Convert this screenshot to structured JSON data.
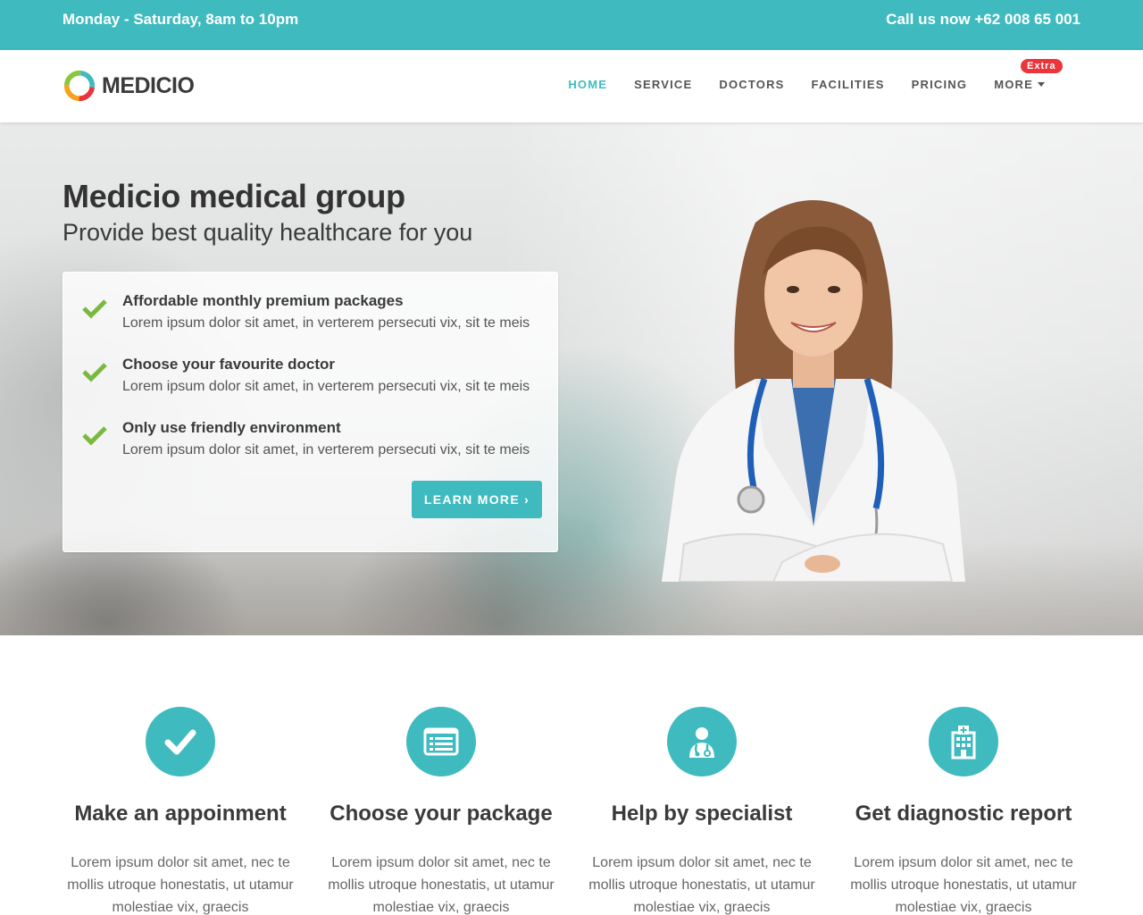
{
  "topbar": {
    "hours": "Monday - Saturday, 8am to 10pm",
    "phone": "Call us now +62 008 65 001"
  },
  "brand": {
    "name": "MEDICIO",
    "accent_color": "#3fbbc0",
    "badge_color": "#e9353b"
  },
  "nav": {
    "items": [
      {
        "label": "HOME",
        "active": true
      },
      {
        "label": "SERVICE"
      },
      {
        "label": "DOCTORS"
      },
      {
        "label": "FACILITIES"
      },
      {
        "label": "PRICING"
      },
      {
        "label": "MORE",
        "dropdown": true
      }
    ],
    "badge": "Extra"
  },
  "hero": {
    "title": "Medicio medical group",
    "subtitle": "Provide best quality healthcare for you",
    "features": [
      {
        "title": "Affordable monthly premium packages",
        "desc": "Lorem ipsum dolor sit amet, in verterem persecuti vix, sit te meis",
        "icon": "check-icon"
      },
      {
        "title": "Choose your favourite doctor",
        "desc": "Lorem ipsum dolor sit amet, in verterem persecuti vix, sit te meis",
        "icon": "check-icon"
      },
      {
        "title": "Only use friendly environment",
        "desc": "Lorem ipsum dolor sit amet, in verterem persecuti vix, sit te meis",
        "icon": "check-icon"
      }
    ],
    "cta": "LEARN MORE ›"
  },
  "services": [
    {
      "icon": "check-circle-icon",
      "title": "Make an appoinment",
      "desc": "Lorem ipsum dolor sit amet, nec te mollis utroque honestatis, ut utamur molestiae vix, graecis"
    },
    {
      "icon": "list-card-icon",
      "title": "Choose your package",
      "desc": "Lorem ipsum dolor sit amet, nec te mollis utroque honestatis, ut utamur molestiae vix, graecis"
    },
    {
      "icon": "doctor-icon",
      "title": "Help by specialist",
      "desc": "Lorem ipsum dolor sit amet, nec te mollis utroque honestatis, ut utamur molestiae vix, graecis"
    },
    {
      "icon": "hospital-icon",
      "title": "Get diagnostic report",
      "desc": "Lorem ipsum dolor sit amet, nec te mollis utroque honestatis, ut utamur molestiae vix, graecis"
    }
  ]
}
